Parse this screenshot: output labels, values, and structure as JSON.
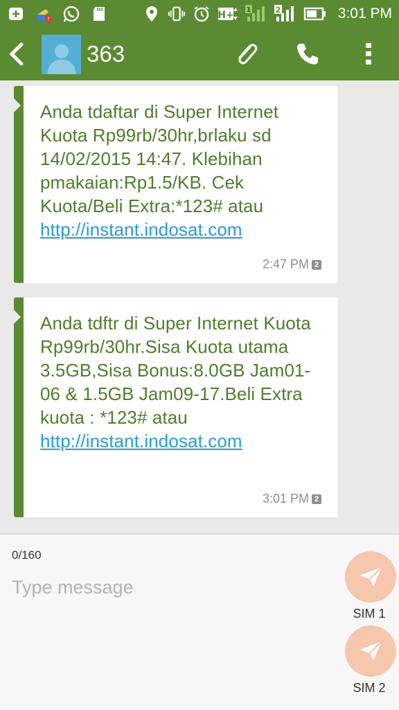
{
  "status_bar": {
    "time": "3:01 PM",
    "icons": [
      "add-box-icon",
      "cleaner-icon",
      "whatsapp-icon",
      "sd-card-icon",
      "location-icon",
      "vibrate-icon",
      "alarm-icon",
      "hplus-network-icon",
      "signal-sim1-icon",
      "signal-sim2-icon",
      "battery-icon"
    ],
    "network_type": "H+",
    "sim1_label": "1",
    "sim2_label": "2"
  },
  "header": {
    "contact": "363",
    "icons": [
      "back-arrow-icon",
      "contact-avatar",
      "attach-icon",
      "phone-icon",
      "overflow-menu-icon"
    ]
  },
  "messages": [
    {
      "text": "Anda tdaftar di Super Internet Kuota Rp99rb/30hr,brlaku sd 14/02/2015 14:47. Klebihan pmakaian:Rp1.5/KB. Cek Kuota/Beli Extra:*123# atau ",
      "link": "http://instant.indosat.com",
      "time": "2:47 PM",
      "sim": "2"
    },
    {
      "text": "Anda tdftr di Super Internet Kuota Rp99rb/30hr.Sisa Kuota utama 3.5GB,Sisa Bonus:8.0GB Jam01-06 & 1.5GB Jam09-17.Beli Extra kuota : *123# atau ",
      "link": "http://instant.indosat.com",
      "time": "3:01 PM",
      "sim": "2"
    }
  ],
  "composer": {
    "counter": "0/160",
    "placeholder": "Type message",
    "value": "",
    "send_sim1": "SIM 1",
    "send_sim2": "SIM 2"
  },
  "colors": {
    "primary": "#5a8a31",
    "message_text": "#4f7d2a",
    "link": "#2a9bd6",
    "send_button": "#f6c6ad",
    "background": "#e9e9e9"
  }
}
